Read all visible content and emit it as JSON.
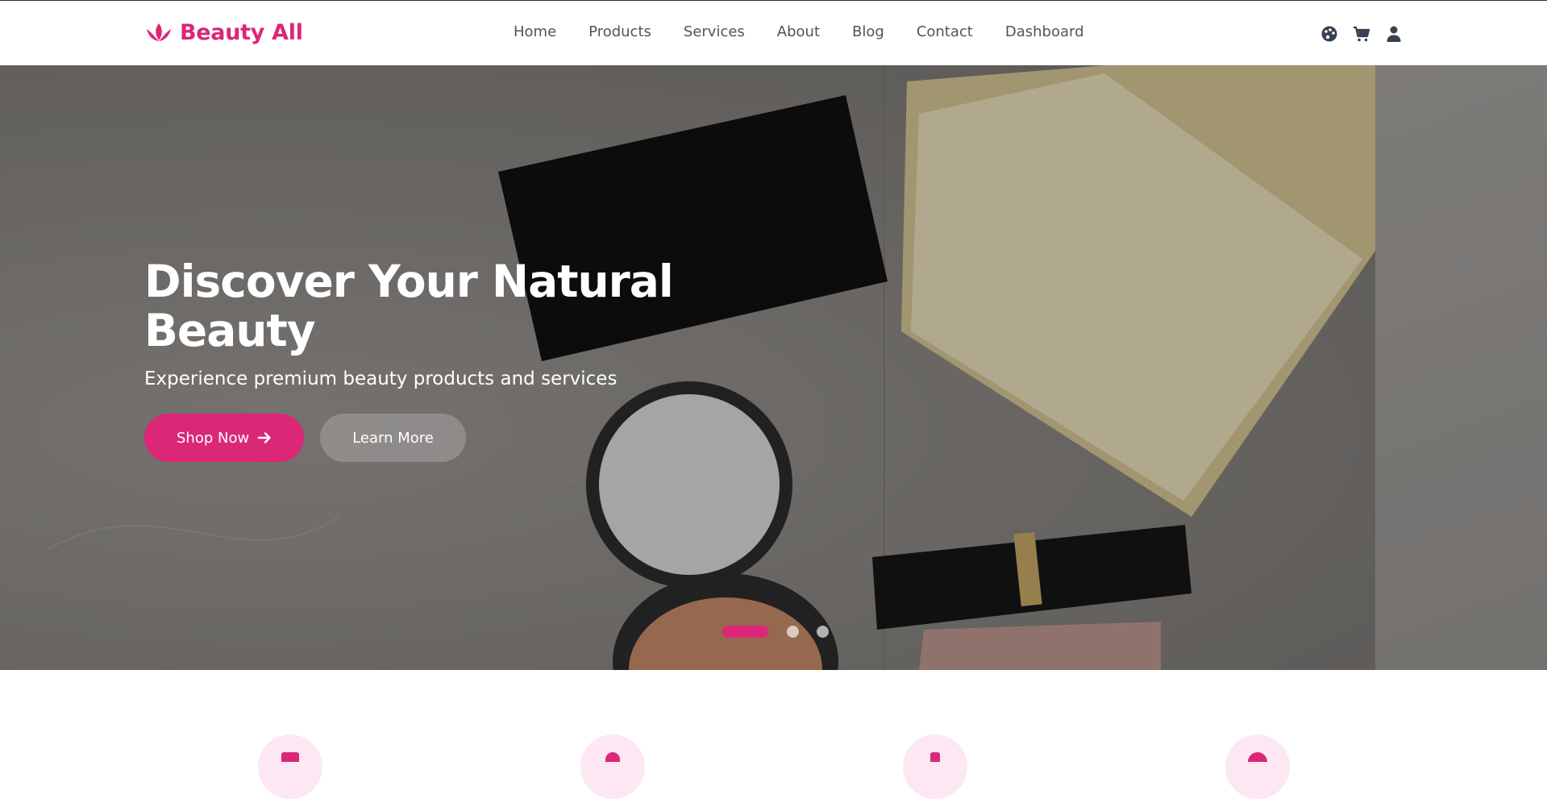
{
  "brand": {
    "name": "Beauty All",
    "icon": "lotus-icon",
    "color": "#db2777"
  },
  "nav": {
    "items": [
      {
        "label": "Home"
      },
      {
        "label": "Products"
      },
      {
        "label": "Services"
      },
      {
        "label": "About"
      },
      {
        "label": "Blog"
      },
      {
        "label": "Contact"
      },
      {
        "label": "Dashboard"
      }
    ]
  },
  "header_icons": [
    "palette-icon",
    "cart-icon",
    "user-icon"
  ],
  "hero": {
    "title": "Discover Your Natural Beauty",
    "subtitle": "Experience premium beauty products and services",
    "primary_button": "Shop Now",
    "primary_icon": "arrow-right-icon",
    "secondary_button": "Learn More",
    "slides": 3,
    "active_slide": 1
  },
  "features": [
    "feature-icon-1",
    "feature-icon-2",
    "feature-icon-3",
    "feature-icon-4"
  ]
}
